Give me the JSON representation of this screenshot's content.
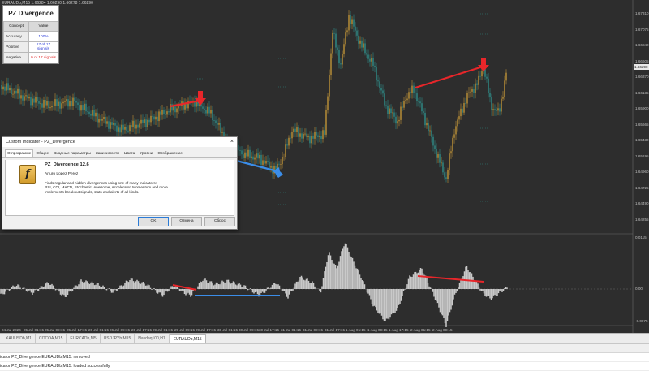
{
  "chart": {
    "top_info": "EURAUDb,M15  1.66284 1.66290 1.66278 1.66290",
    "price_labels": [
      "1.67310",
      "1.67075",
      "1.66840",
      "1.66605",
      "1.66370",
      "1.66135",
      "1.65900",
      "1.65665",
      "1.65430",
      "1.65195",
      "1.64960",
      "1.64725",
      "1.64490",
      "1.64255"
    ],
    "current_price": "1.66290",
    "osc_labels": [
      "0.0115",
      "0.00",
      "-0.0075"
    ],
    "time_labels": [
      "24 Jul 2024",
      "25 Jul 01:15",
      "25 Jul 09:15",
      "25 Jul 17:15",
      "26 Jul 01:15",
      "26 Jul 09:15",
      "26 Jul 17:15",
      "29 Jul 01:15",
      "29 Jul 09:15",
      "29 Jul 17:15",
      "30 Jul 01:15",
      "30 Jul 09:15",
      "30 Jul 17:15",
      "31 Jul 01:15",
      "31 Jul 09:15",
      "31 Jul 17:15",
      "1 Aug 01:15",
      "1 Aug 09:15",
      "1 Aug 17:15",
      "2 Aug 01:15",
      "2 Aug 09:15"
    ],
    "colors": {
      "bull": "#d9a53a",
      "bear": "#2f9e9a",
      "bullish_divergence": "#3b8de8",
      "bearish_divergence": "#e8262a",
      "osc_fill": "#c9c9c9"
    }
  },
  "stats": {
    "title": "PZ Divergence",
    "headers": [
      "Concept",
      "Value"
    ],
    "rows": [
      {
        "concept": "Accuracy",
        "value": "100%"
      },
      {
        "concept": "Positive",
        "value": "17 of 17 signals"
      },
      {
        "concept": "Negative",
        "value": "0 of 17 signals"
      }
    ]
  },
  "dialog": {
    "title": "Custom Indicator - PZ_Divergence",
    "close_icon": "×",
    "tabs": [
      "О программе",
      "Общие",
      "Входные параметры",
      "Зависимости",
      "Цвета",
      "Уровни",
      "Отображение"
    ],
    "indicator_name": "PZ_Divergence 12.6",
    "author": "Arturo Lopez Perez",
    "description": [
      "Finds regular and hidden divergences using one of many indicators:",
      "RSI, CCI, MACD, Stochastic, Awesome, Accelerator, Momentum and more.",
      "Implements breakout signals, stats and alerts of all kinds."
    ],
    "buttons": {
      "ok": "OK",
      "cancel": "Отмена",
      "reset": "Сброс"
    }
  },
  "symbol_tabs": [
    "XAUUSDb,M1",
    "COCOA,M15",
    "EURCADb,M5",
    "USDJPYb,M15",
    "Nasdaq100,H1",
    "EURAUDb,M15"
  ],
  "active_tab": "EURAUDb,M15",
  "log": [
    "icator PZ_Divergence EURAUDb,M15: removed",
    "icator PZ_Divergence EURAUDb,M15: loaded successfully"
  ]
}
